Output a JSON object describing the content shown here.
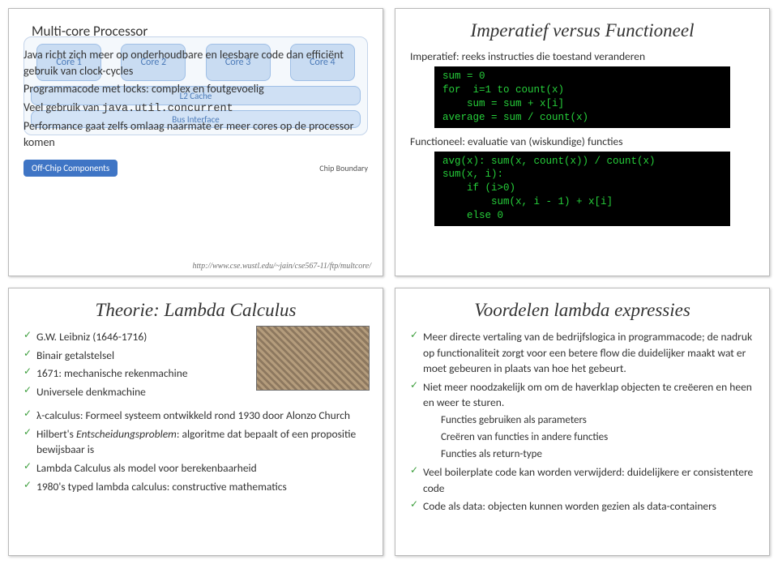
{
  "panel1": {
    "title": "Multi-core Processor",
    "diagram": {
      "core1": "Core 1",
      "core2": "Core 2",
      "core3": "Core 3",
      "core4": "Core 4",
      "cache": "L2 Cache",
      "bus": "Bus Interface",
      "offchip": "Off-Chip Components",
      "boundary": "Chip Boundary"
    },
    "line1": "Java richt zich meer op onderhoudbare en leesbare code dan efficiënt gebruik van clock-cycles",
    "line2": "Programmacode met locks: complex en foutgevoelig",
    "line3a": "Veel gebruik van ",
    "line3b": "java.util.concurrent",
    "line4": "Performance gaat zelfs omlaag naarmate er meer cores op de processor komen",
    "link": "http://www.cse.wustl.edu/~jain/cse567-11/ftp/multcore/"
  },
  "panel2": {
    "title": "Imperatief versus Functioneel",
    "sub1": "Imperatief: reeks instructies die toestand veranderen",
    "code1": "sum = 0\nfor  i=1 to count(x)\n    sum = sum + x[i]\naverage = sum / count(x)",
    "sub2": "Functioneel: evaluatie van (wiskundige) functies",
    "code2": "avg(x): sum(x, count(x)) / count(x)\nsum(x, i):\n    if (i>0)\n        sum(x, i - 1) + x[i]\n    else 0"
  },
  "panel3": {
    "title": "Theorie: Lambda Calculus",
    "top": {
      "b1": "G.W. Leibniz (1646-1716)",
      "b2": "Binair getalstelsel",
      "b3": "1671: mechanische rekenmachine",
      "b4": "Universele denkmachine"
    },
    "bottom": {
      "b1": "λ-calculus: Formeel systeem ontwikkeld rond 1930 door Alonzo Church",
      "b2a": "Hilbert's ",
      "b2b": "Entscheidungsproblem",
      "b2c": ": algoritme dat bepaalt of een propositie bewijsbaar is",
      "b3": "Lambda Calculus als model voor berekenbaarheid",
      "b4": "1980's typed lambda calculus: constructive mathematics"
    }
  },
  "panel4": {
    "title": "Voordelen lambda expressies",
    "b1": "Meer directe vertaling van de bedrijfslogica in programmacode; de nadruk op functionaliteit zorgt voor een betere flow die duidelijker maakt wat er moet gebeuren in plaats van hoe het gebeurt.",
    "b2": "Niet meer noodzakelijk om om de haverklap objecten te creëeren en heen en weer te sturen.",
    "sub": {
      "s1": "Functies gebruiken als parameters",
      "s2": "Creëren van functies in andere functies",
      "s3": "Functies als return-type"
    },
    "b3": "Veel boilerplate code kan worden verwijderd: duidelijkere er consistentere code",
    "b4": "Code als data: objecten kunnen worden gezien als data-containers"
  }
}
